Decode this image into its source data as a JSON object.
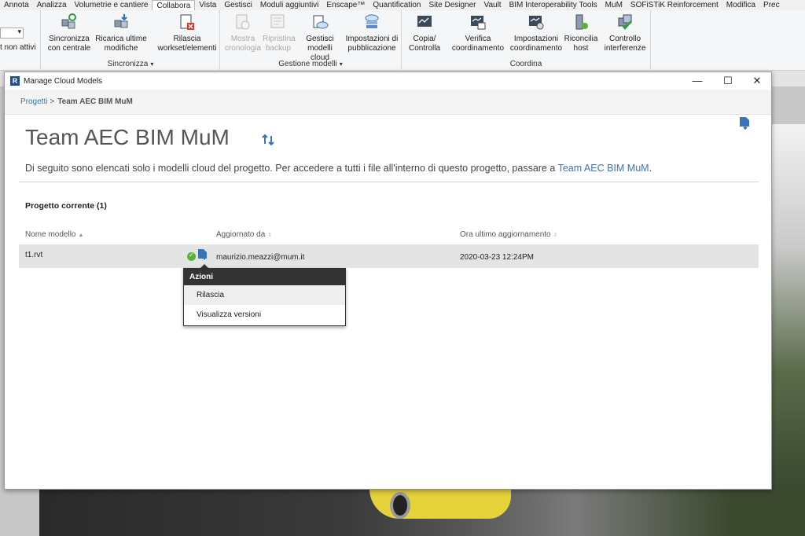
{
  "ribbon": {
    "tabs": [
      "Annota",
      "Analizza",
      "Volumetrie e cantiere",
      "Collabora",
      "Vista",
      "Gestisci",
      "Moduli aggiuntivi",
      "Enscape™",
      "Quantification",
      "Site Designer",
      "Vault",
      "BIM Interoperability Tools",
      "MuM",
      "SOFiSTiK Reinforcement",
      "Modifica",
      "Prec"
    ],
    "active_tab": "Collabora",
    "left_label": "t non attivi",
    "panels": [
      {
        "title": "Sincronizza",
        "buttons": [
          "Sincronizza con centrale",
          "Ricarica ultime modifiche",
          "Rilascia workset/elementi"
        ]
      },
      {
        "title": "Gestione modelli",
        "buttons": [
          "Mostra cronologia",
          "Ripristina backup",
          "Gestisci modelli cloud",
          "Impostazioni di pubblicazione"
        ]
      },
      {
        "title": "Coordina",
        "buttons": [
          "Copia/ Controlla",
          "Verifica coordinamento",
          "Impostazioni coordinamento",
          "Riconcilia host",
          "Controllo interferenze"
        ]
      }
    ]
  },
  "dialog": {
    "title": "Manage Cloud Models",
    "breadcrumb_root": "Progetti",
    "breadcrumb_current": "Team AEC BIM MuM",
    "heading": "Team AEC BIM MuM",
    "description_prefix": "Di seguito sono elencati solo i modelli cloud del progetto. Per accedere a tutti i file all'interno di questo progetto, passare a ",
    "description_link": "Team AEC BIM MuM",
    "description_suffix": ".",
    "section_title": "Progetto corrente (1)",
    "columns": [
      "Nome modello",
      "Aggiornato da",
      "Ora ultimo aggiornamento"
    ],
    "rows": [
      {
        "name": "t1.rvt",
        "updated_by": "maurizio.meazzi@mum.it",
        "updated_at": "2020-03-23 12:24PM"
      }
    ],
    "menu": {
      "title": "Azioni",
      "items": [
        "Rilascia",
        "Visualizza versioni"
      ]
    }
  }
}
